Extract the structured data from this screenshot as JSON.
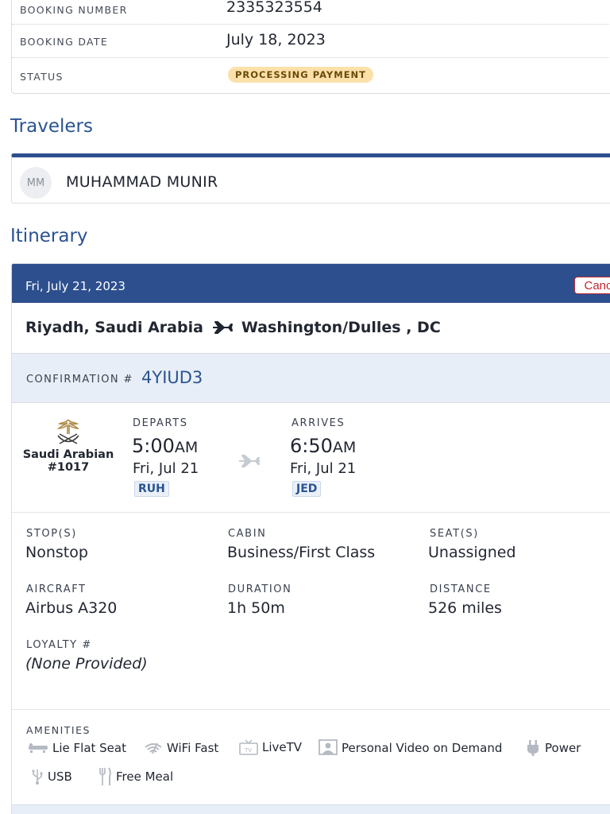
{
  "booking": {
    "number_label": "BOOKING NUMBER",
    "number_value": "2335323554",
    "date_label": "BOOKING DATE",
    "date_value": "July 18, 2023",
    "status_label": "STATUS",
    "status_value": "PROCESSING PAYMENT",
    "status_color": "#fbe0a9"
  },
  "travelers": {
    "title": "Travelers",
    "list": [
      {
        "initials": "MM",
        "name": "MUHAMMAD MUNIR"
      }
    ]
  },
  "itinerary": {
    "title": "Itinerary",
    "header_color": "#2d4f8e",
    "date": "Fri, July 21, 2023",
    "cancel_label": "Canc",
    "origin": "Riyadh, Saudi Arabia",
    "destination": "Washington/Dulles , DC",
    "confirmation_label": "CONFIRMATION #",
    "confirmation_code": "4YIUD3",
    "airline": "Saudi Arabian",
    "flight_number": "#1017",
    "departs": {
      "label": "DEPARTS",
      "time": "5:00",
      "ampm": "AM",
      "day": "Fri, Jul 21",
      "airport": "RUH"
    },
    "arrives": {
      "label": "ARRIVES",
      "time": "6:50",
      "ampm": "AM",
      "day": "Fri, Jul 21",
      "airport": "JED"
    },
    "details": {
      "stops_label": "STOP(S)",
      "stops_value": "Nonstop",
      "cabin_label": "CABIN",
      "cabin_value": "Business/First Class",
      "seats_label": "SEAT(S)",
      "seats_value": "Unassigned",
      "aircraft_label": "AIRCRAFT",
      "aircraft_value": "Airbus A320",
      "duration_label": "DURATION",
      "duration_value": "1h 50m",
      "distance_label": "DISTANCE",
      "distance_value": "526 miles",
      "loyalty_label": "LOYALTY #",
      "loyalty_value": "(None Provided)"
    },
    "amenities_label": "AMENITIES",
    "amenities": [
      {
        "label": "Lie Flat Seat",
        "icon": "lie-flat-seat-icon"
      },
      {
        "label": "WiFi Fast",
        "icon": "wifi-icon"
      },
      {
        "label": "LiveTV",
        "icon": "tv-icon"
      },
      {
        "label": "Personal Video on Demand",
        "icon": "personal-video-icon"
      },
      {
        "label": "Power",
        "icon": "power-plug-icon"
      },
      {
        "label": "USB",
        "icon": "usb-icon"
      },
      {
        "label": "Free Meal",
        "icon": "meal-icon"
      }
    ]
  }
}
